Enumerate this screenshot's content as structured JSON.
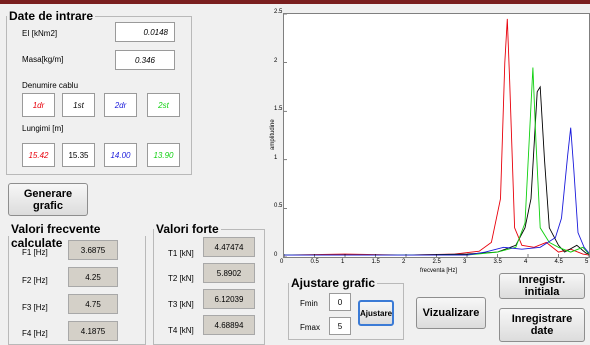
{
  "input_panel": {
    "legend": "Date de intrare",
    "ei_label": "EI [kNm2]",
    "ei_value": "0.0148",
    "masa_label": "Masa[kg/m]",
    "masa_value": "0.346",
    "denumire_label": "Denumire cablu",
    "names": [
      {
        "text": "1dr",
        "color": "#e8000b"
      },
      {
        "text": "1st",
        "color": "#000000"
      },
      {
        "text": "2dr",
        "color": "#1a1adb"
      },
      {
        "text": "2st",
        "color": "#10d010"
      }
    ],
    "lungimi_label": "Lungimi [m]",
    "lengths": [
      {
        "text": "15.42",
        "color": "#e8000b"
      },
      {
        "text": "15.35",
        "color": "#000000"
      },
      {
        "text": "14.00",
        "color": "#1a1adb"
      },
      {
        "text": "13.90",
        "color": "#10d010"
      }
    ]
  },
  "generate_button": "Generare grafic",
  "freq_panel": {
    "legend": "Valori frecvente calculate",
    "rows": [
      {
        "label": "F1 [Hz]",
        "value": "3.6875"
      },
      {
        "label": "F2 [Hz]",
        "value": "4.25"
      },
      {
        "label": "F3 [Hz]",
        "value": "4.75"
      },
      {
        "label": "F4 [Hz]",
        "value": "4.1875"
      }
    ]
  },
  "force_panel": {
    "legend": "Valori forte",
    "rows": [
      {
        "label": "T1 [kN]",
        "value": "4.47474"
      },
      {
        "label": "T2 [kN]",
        "value": "5.8902"
      },
      {
        "label": "T3 [kN]",
        "value": "6.12039"
      },
      {
        "label": "T4 [kN]",
        "value": "4.68894"
      }
    ]
  },
  "adjust_panel": {
    "legend": "Ajustare grafic",
    "fmin_label": "Fmin",
    "fmin_value": "0",
    "fmax_label": "Fmax",
    "fmax_value": "5",
    "adjust_button": "Ajustare"
  },
  "buttons": {
    "visualize": "Vizualizare",
    "register_initial": "Inregistr. initiala",
    "register_data": "Inregistrare date"
  },
  "chart_data": {
    "type": "line",
    "xlabel": "frecventa [Hz]",
    "ylabel": "amplitudine",
    "xlim": [
      0,
      5
    ],
    "ylim": [
      0,
      2.5
    ],
    "x_ticks": [
      "0",
      "0.5",
      "1",
      "1.5",
      "2",
      "2.5",
      "3",
      "3.5",
      "4",
      "4.5",
      "5"
    ],
    "y_ticks": [
      "0",
      "0.5",
      "1",
      "1.5",
      "2",
      "2.5"
    ],
    "series": [
      {
        "color": "#e8000b",
        "points": [
          [
            0,
            0.02
          ],
          [
            1,
            0.03
          ],
          [
            2,
            0.02
          ],
          [
            2.8,
            0.03
          ],
          [
            3.2,
            0.06
          ],
          [
            3.4,
            0.15
          ],
          [
            3.55,
            0.6
          ],
          [
            3.62,
            2.0
          ],
          [
            3.66,
            2.45
          ],
          [
            3.7,
            1.8
          ],
          [
            3.78,
            0.3
          ],
          [
            3.9,
            0.12
          ],
          [
            4.1,
            0.1
          ],
          [
            4.3,
            0.15
          ],
          [
            4.5,
            0.05
          ],
          [
            4.7,
            0.08
          ],
          [
            4.9,
            0.03
          ],
          [
            5,
            0.02
          ]
        ]
      },
      {
        "color": "#000000",
        "points": [
          [
            0,
            0.02
          ],
          [
            1,
            0.02
          ],
          [
            2,
            0.02
          ],
          [
            3,
            0.03
          ],
          [
            3.5,
            0.05
          ],
          [
            3.8,
            0.12
          ],
          [
            3.95,
            0.3
          ],
          [
            4.05,
            0.6
          ],
          [
            4.15,
            1.7
          ],
          [
            4.2,
            1.75
          ],
          [
            4.27,
            1.0
          ],
          [
            4.35,
            0.3
          ],
          [
            4.5,
            0.12
          ],
          [
            4.6,
            0.05
          ],
          [
            4.8,
            0.12
          ],
          [
            4.95,
            0.04
          ],
          [
            5,
            0.03
          ]
        ]
      },
      {
        "color": "#10d010",
        "points": [
          [
            0,
            0.02
          ],
          [
            1,
            0.02
          ],
          [
            2,
            0.02
          ],
          [
            3,
            0.02
          ],
          [
            3.5,
            0.05
          ],
          [
            3.8,
            0.1
          ],
          [
            3.95,
            0.35
          ],
          [
            4.02,
            1.2
          ],
          [
            4.08,
            1.95
          ],
          [
            4.13,
            1.2
          ],
          [
            4.2,
            0.3
          ],
          [
            4.35,
            0.15
          ],
          [
            4.5,
            0.1
          ],
          [
            4.7,
            0.05
          ],
          [
            4.9,
            0.1
          ],
          [
            5,
            0.03
          ]
        ]
      },
      {
        "color": "#1a1adb",
        "points": [
          [
            0,
            0.02
          ],
          [
            1,
            0.02
          ],
          [
            2,
            0.02
          ],
          [
            3,
            0.02
          ],
          [
            3.3,
            0.05
          ],
          [
            3.6,
            0.1
          ],
          [
            3.9,
            0.08
          ],
          [
            4.2,
            0.1
          ],
          [
            4.45,
            0.2
          ],
          [
            4.55,
            0.4
          ],
          [
            4.65,
            1.05
          ],
          [
            4.7,
            1.33
          ],
          [
            4.75,
            0.9
          ],
          [
            4.82,
            0.25
          ],
          [
            4.92,
            0.1
          ],
          [
            5,
            0.04
          ]
        ]
      }
    ]
  }
}
